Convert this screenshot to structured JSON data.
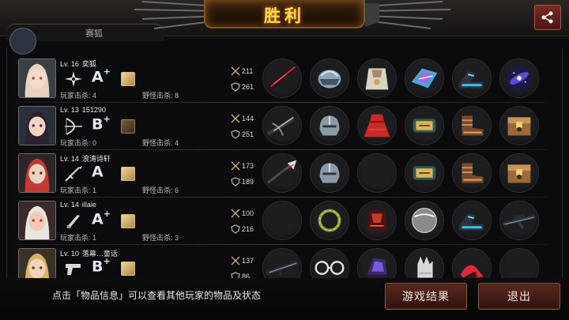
{
  "header": {
    "title": "胜利",
    "share_icon": "share-icon",
    "tab_text": "赛狐"
  },
  "labels": {
    "player_kills": "玩家击杀",
    "monster_kills": "野怪击杀"
  },
  "players": [
    {
      "level": "Lv. 16",
      "name": "奕狐",
      "weapon_icon": "shuriken-icon",
      "grade": "A",
      "grade_plus": "+",
      "player_kills": "4",
      "monster_kills": "8",
      "kills": "211",
      "defense": "261",
      "items": [
        "dark-blade-icon",
        "silver-helmet-icon",
        "white-armor-icon",
        "blue-arm-guard-icon",
        "blue-boots-icon",
        "galaxy-orb-icon"
      ]
    },
    {
      "level": "Lv. 13",
      "name": "151290",
      "weapon_icon": "bow-icon",
      "grade": "B",
      "grade_plus": "+",
      "player_kills": "0",
      "monster_kills": "4",
      "kills": "144",
      "defense": "251",
      "items": [
        "crossbow-icon",
        "steel-helmet-icon",
        "red-dress-icon",
        "gold-bracer-icon",
        "leather-boots-icon",
        "treasure-box-icon"
      ]
    },
    {
      "level": "Lv. 14",
      "name": "浪涛诗轩",
      "weapon_icon": "spear-icon",
      "grade": "A",
      "grade_plus": "",
      "player_kills": "1",
      "monster_kills": "6",
      "kills": "173",
      "defense": "189",
      "items": [
        "spiked-lance-icon",
        "steel-helmet-icon",
        "empty-slot",
        "gold-bracer-icon",
        "leather-boots-icon",
        "treasure-box-icon"
      ]
    },
    {
      "level": "Lv. 14",
      "name": "illaie",
      "weapon_icon": "dagger-icon",
      "grade": "A",
      "grade_plus": "+",
      "player_kills": "1",
      "monster_kills": "3",
      "kills": "100",
      "defense": "216",
      "items": [
        "empty-slot",
        "laurel-wreath-icon",
        "crimson-armor-icon",
        "steel-disc-icon",
        "blue-boots-icon",
        "sniper-rifle-icon"
      ]
    },
    {
      "level": "Lv. 10",
      "name": "落幕…童话",
      "weapon_icon": "pistol-icon",
      "grade": "B",
      "grade_plus": "+",
      "player_kills": "",
      "monster_kills": "",
      "kills": "137",
      "defense": "86",
      "items": [
        "assault-rifle-icon",
        "glasses-icon",
        "purple-gauntlet-icon",
        "white-glove-icon",
        "red-heels-icon",
        "empty-slot"
      ]
    }
  ],
  "footer": {
    "hint": "点击「物品信息」可以查看其他玩家的物品及状态",
    "result_button": "游戏结果",
    "exit_button": "退出"
  }
}
